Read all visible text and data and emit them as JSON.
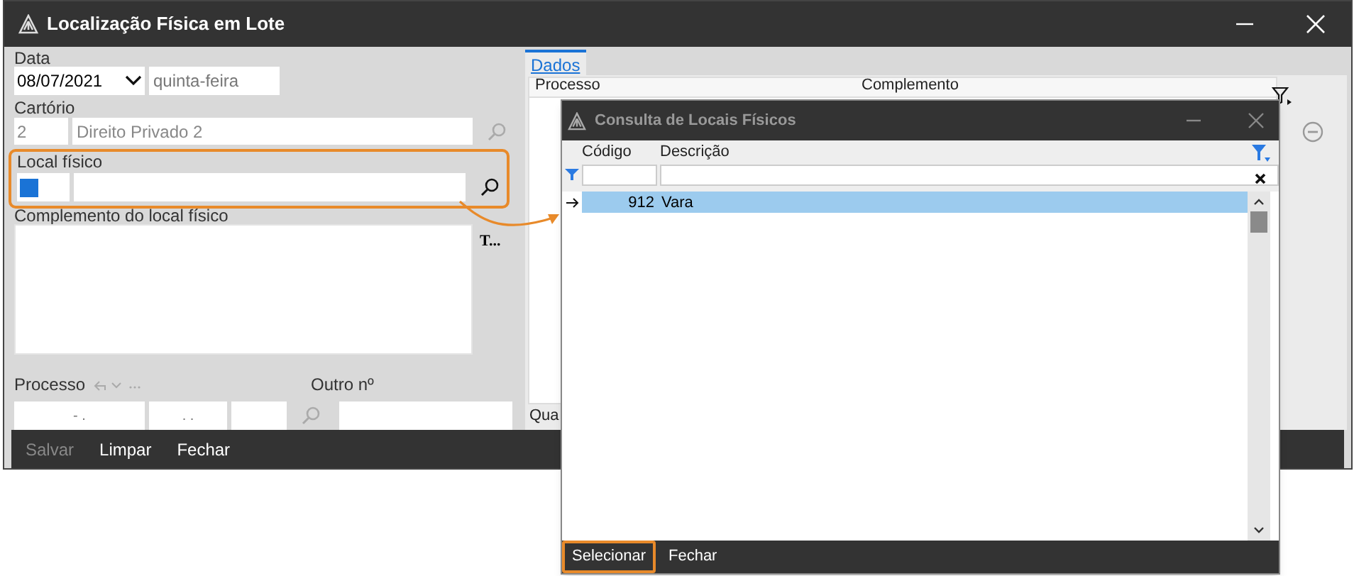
{
  "main_window": {
    "title": "Localização Física em Lote",
    "form": {
      "data": {
        "label": "Data",
        "value": "08/07/2021",
        "weekday": "quinta-feira"
      },
      "cartorio": {
        "label": "Cartório",
        "code": "2",
        "name": "Direito Privado 2",
        "disabled": true
      },
      "local_fisico": {
        "label": "Local físico",
        "highlighted": true
      },
      "complemento": {
        "label": "Complemento do local físico",
        "side_label": "T..."
      },
      "processo": {
        "label": "Processo",
        "parts": [
          "- .",
          ". ."
        ]
      },
      "outro": {
        "label": "Outro nº"
      }
    },
    "tabs": [
      {
        "label": "Dados",
        "selected": true
      }
    ],
    "grid": {
      "columns": [
        "Processo",
        "Complemento"
      ],
      "footer": "Qua"
    },
    "buttons": [
      {
        "label": "Salvar",
        "disabled": true
      },
      {
        "label": "Limpar",
        "disabled": false
      },
      {
        "label": "Fechar",
        "disabled": false
      }
    ]
  },
  "dialog": {
    "title": "Consulta de Locais Físicos",
    "columns": [
      "Código",
      "Descrição"
    ],
    "rows": [
      {
        "codigo": "912",
        "descricao": "Vara",
        "selected": true
      }
    ],
    "buttons": [
      {
        "label": "Selecionar",
        "highlighted": true
      },
      {
        "label": "Fechar",
        "highlighted": false
      }
    ]
  }
}
